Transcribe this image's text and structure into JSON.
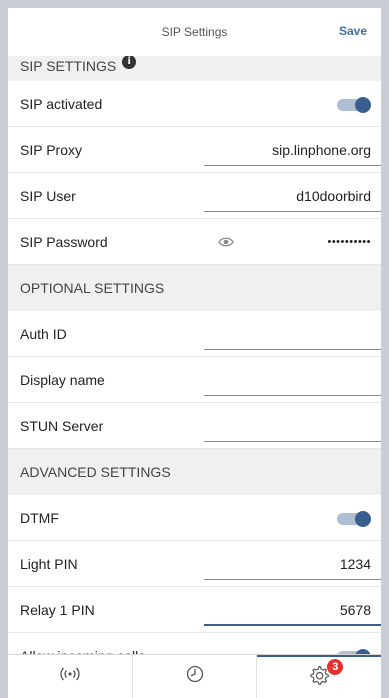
{
  "header": {
    "title": "SIP Settings",
    "save_label": "Save"
  },
  "sections": {
    "sip": {
      "title": "SIP SETTINGS",
      "info_glyph": "i"
    },
    "optional": {
      "title": "OPTIONAL SETTINGS"
    },
    "advanced": {
      "title": "ADVANCED SETTINGS"
    }
  },
  "rows": {
    "sip_activated": {
      "label": "SIP activated",
      "toggle_on": true
    },
    "sip_proxy": {
      "label": "SIP Proxy",
      "value": "sip.linphone.org"
    },
    "sip_user": {
      "label": "SIP User",
      "value": "d10doorbird"
    },
    "sip_password": {
      "label": "SIP Password",
      "value": "••••••••••"
    },
    "auth_id": {
      "label": "Auth ID",
      "value": ""
    },
    "display_name": {
      "label": "Display name",
      "value": ""
    },
    "stun_server": {
      "label": "STUN Server",
      "value": ""
    },
    "dtmf": {
      "label": "DTMF",
      "toggle_on": true
    },
    "light_pin": {
      "label": "Light PIN",
      "value": "1234"
    },
    "relay_pin": {
      "label": "Relay 1 PIN",
      "value": "5678"
    },
    "allow_calls": {
      "label": "Allow incoming calls",
      "toggle_on": true
    }
  },
  "tabbar": {
    "items": [
      {
        "icon": "broadcast-icon"
      },
      {
        "icon": "clock-icon"
      },
      {
        "icon": "gear-icon",
        "badge": "3"
      }
    ]
  },
  "colors": {
    "accent": "#3a5f8f",
    "badge": "#e53030",
    "section_bg": "#f0f0f0"
  }
}
